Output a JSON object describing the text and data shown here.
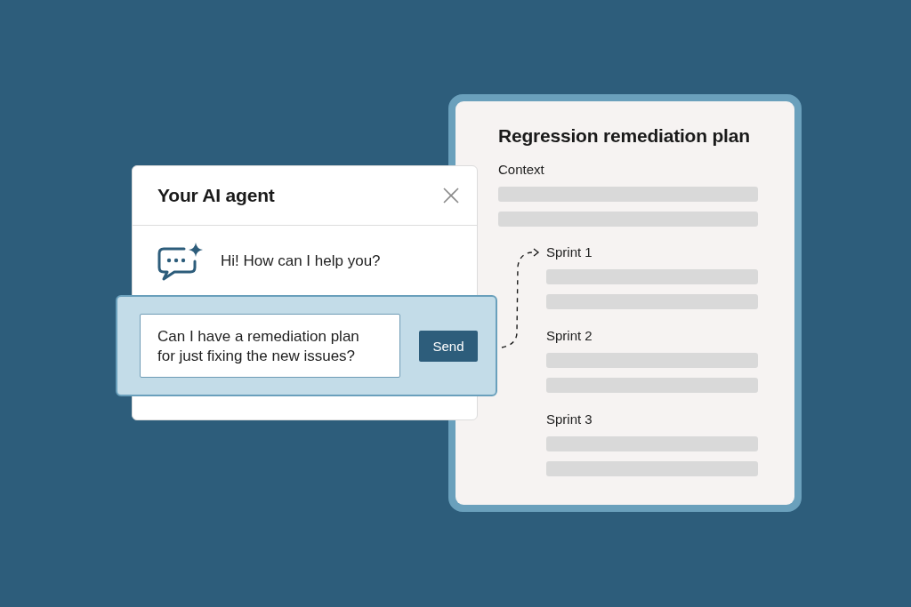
{
  "chat_panel": {
    "title": "Your AI agent",
    "messages": [
      {
        "kind": "agent",
        "text": "Hi! How can I help you?"
      }
    ],
    "composer": {
      "value": "Can I have a remediation plan for just fixing the new issues?",
      "send_button": "Send"
    }
  },
  "plan_document": {
    "title": "Regression remediation plan",
    "sections": [
      {
        "kind": "intro",
        "heading": "Context"
      },
      {
        "kind": "sprint",
        "heading": "Sprint 1"
      },
      {
        "kind": "sprint",
        "heading": "Sprint 2"
      },
      {
        "kind": "sprint",
        "heading": "Sprint 3"
      }
    ]
  }
}
